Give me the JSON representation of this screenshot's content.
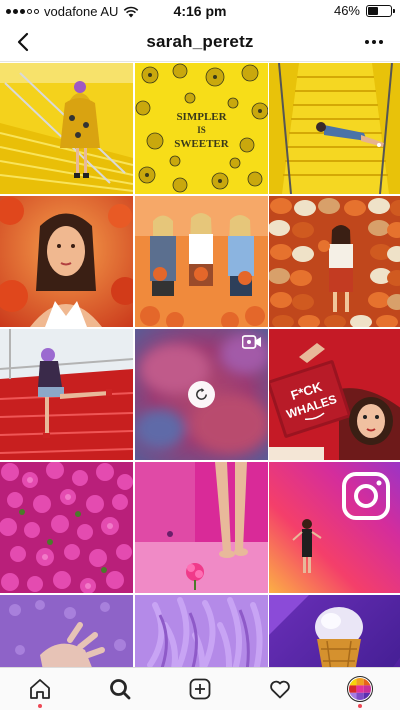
{
  "status_bar": {
    "carrier": "vodafone AU",
    "time": "4:16 pm",
    "battery": "46%",
    "battery_level": 0.46
  },
  "header": {
    "username": "sarah_peretz"
  },
  "posts": [
    {
      "type": "photo",
      "scene": "yellow-stairs-woman-dress"
    },
    {
      "type": "photo",
      "scene": "yellow-flowers-text",
      "caption_lines": [
        "SIMPLER",
        "IS",
        "SWEETER"
      ]
    },
    {
      "type": "photo",
      "scene": "yellow-stairs-woman-lying"
    },
    {
      "type": "photo",
      "scene": "orange-portrait"
    },
    {
      "type": "photo",
      "scene": "three-women-pumpkins"
    },
    {
      "type": "photo",
      "scene": "pumpkin-wall-woman"
    },
    {
      "type": "photo",
      "scene": "red-stairs-woman"
    },
    {
      "type": "video",
      "scene": "blurred-video-loading"
    },
    {
      "type": "photo",
      "scene": "woman-with-red-book",
      "book_lines": [
        "F*CK",
        "WHALES"
      ]
    },
    {
      "type": "photo",
      "scene": "pink-bougainvillea"
    },
    {
      "type": "photo",
      "scene": "pink-legs-flower"
    },
    {
      "type": "photo",
      "scene": "instagram-logo-woman"
    },
    {
      "type": "photo",
      "scene": "purple-hands"
    },
    {
      "type": "photo",
      "scene": "purple-hair"
    },
    {
      "type": "photo",
      "scene": "purple-ice-cream"
    }
  ],
  "tab_bar": {
    "items": [
      {
        "icon": "home-icon",
        "active": false,
        "badge": true
      },
      {
        "icon": "search-icon",
        "active": true,
        "badge": false
      },
      {
        "icon": "add-post-icon",
        "active": false,
        "badge": false
      },
      {
        "icon": "heart-icon",
        "active": false,
        "badge": false
      },
      {
        "icon": "profile-avatar",
        "active": false,
        "badge": true
      }
    ]
  },
  "colors": {
    "yellow": "#f6d40a",
    "orange": "#e8631a",
    "red": "#d62a2a",
    "pink": "#e2339b",
    "purple": "#a77de6",
    "notification_dot": "#ed4956"
  }
}
